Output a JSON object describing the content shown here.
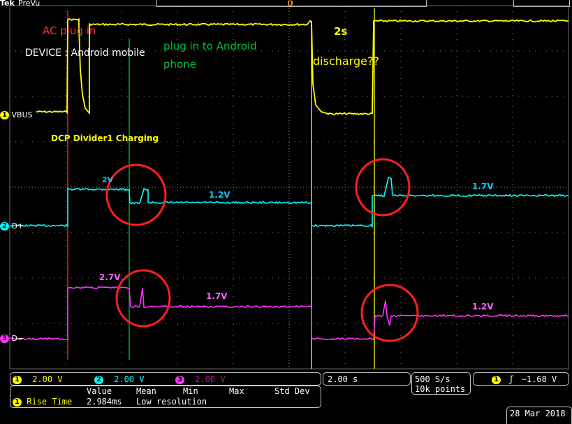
{
  "header": {
    "brand": "Tek",
    "mode": "PreVu"
  },
  "channels": [
    {
      "id": "1",
      "name": "VBUS",
      "scale": "2.00 V",
      "color": "#ffff00"
    },
    {
      "id": "2",
      "name": "D+",
      "scale": "2.00 V",
      "color": "#00ffff"
    },
    {
      "id": "3",
      "name": "D−",
      "scale": "2.00 V",
      "color": "#ff33ff"
    }
  ],
  "annotations": {
    "ac_plug": "AC plug in",
    "device": "DEVICE : Android mobile",
    "plug_android_1": "plug in to Android",
    "plug_android_2": "phone",
    "two_s": "2s",
    "discharge": "discharge??",
    "dcp": "DCP Divider1 Charging",
    "dp_2v": "2V",
    "dp_1_2v": "1.2V",
    "dp_1_7v": "1.7V",
    "dm_2_7v": "2.7V",
    "dm_1_7v": "1.7V",
    "dm_1_2v": "1.2V"
  },
  "measurement": {
    "headers": [
      "Value",
      "Mean",
      "Min",
      "Max",
      "Std Dev"
    ],
    "row_channel": "1",
    "row_label": "Rise Time",
    "row_value": "2.984ms",
    "row_note": "Low resolution"
  },
  "timebase": "2.00 s",
  "sample_rate": "500 S/s",
  "record_length": "10k points",
  "trigger": {
    "channel": "1",
    "level": "−1.68 V"
  },
  "date": "28 Mar 2018",
  "colors": {
    "ch1": "#ffff00",
    "ch2": "#00ffff",
    "ch3": "#ff33ff",
    "cursor_red": "#ff3030",
    "cursor_green": "#00c040",
    "cursor_yellow": "#ffff00",
    "circle": "#ff2020",
    "grid": "#7a7a7a"
  }
}
